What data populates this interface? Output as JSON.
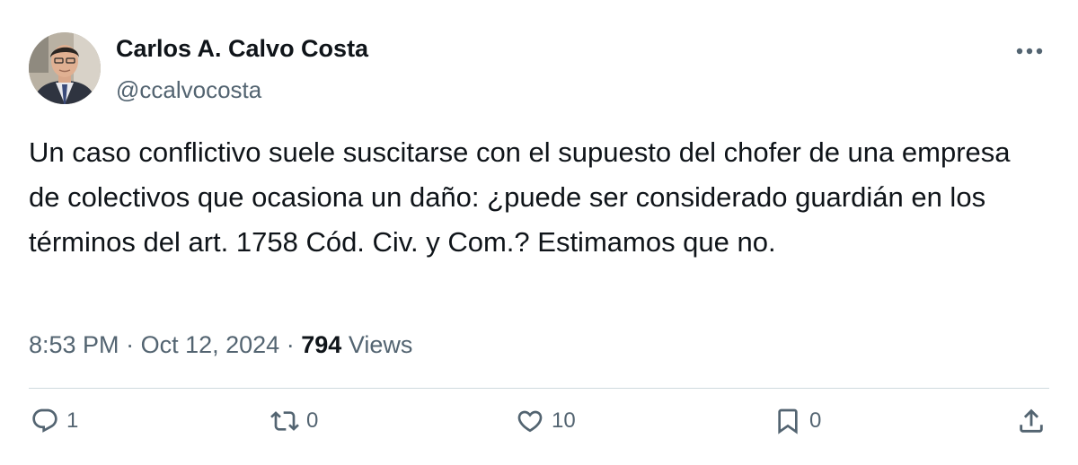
{
  "author": {
    "name": "Carlos A. Calvo Costa",
    "handle": "@ccalvocosta"
  },
  "tweet": {
    "text": "Un caso conflictivo suele suscitarse con el supuesto del chofer de una empresa de colectivos que ocasiona un daño: ¿puede ser considerado guardián en los términos del art. 1758 Cód. Civ. y Com.? Estimamos que no.",
    "time": "8:53 PM",
    "separator": "·",
    "date": "Oct 12, 2024",
    "views_count": "794",
    "views_label": "Views"
  },
  "actions": {
    "replies": "1",
    "retweets": "0",
    "likes": "10",
    "bookmarks": "0"
  },
  "icons": {
    "more": "more-horizontal-icon",
    "reply": "reply-icon",
    "retweet": "retweet-icon",
    "like": "heart-icon",
    "bookmark": "bookmark-icon",
    "share": "share-icon"
  },
  "colors": {
    "text_primary": "#0f1419",
    "text_secondary": "#536471",
    "divider": "#cfd9de",
    "background": "#ffffff"
  }
}
